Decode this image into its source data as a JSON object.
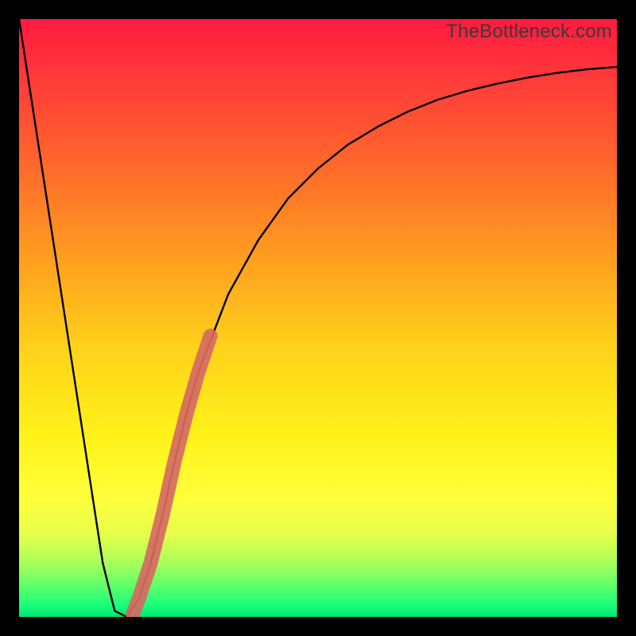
{
  "watermark": "TheBottleneck.com",
  "chart_data": {
    "type": "line",
    "title": "",
    "xlabel": "",
    "ylabel": "",
    "xlim": [
      0,
      100
    ],
    "ylim": [
      0,
      100
    ],
    "series": [
      {
        "name": "bottleneck-curve",
        "x": [
          0,
          2,
          4,
          6,
          8,
          10,
          12,
          14,
          16,
          18,
          20,
          22,
          24,
          26,
          28,
          30,
          35,
          40,
          45,
          50,
          55,
          60,
          65,
          70,
          75,
          80,
          85,
          90,
          95,
          100
        ],
        "values": [
          100,
          87,
          74,
          61,
          48,
          35,
          22,
          9,
          1,
          0,
          3,
          9,
          17,
          26,
          34,
          41,
          54,
          63,
          70,
          75,
          79,
          82,
          84.5,
          86.5,
          88,
          89.2,
          90.2,
          91,
          91.6,
          92
        ]
      }
    ],
    "highlight_segment": {
      "name": "highlighted-range",
      "color": "#d66a62",
      "x": [
        19,
        20,
        22,
        24,
        26,
        28,
        30,
        31,
        32
      ],
      "values": [
        0.5,
        3,
        9,
        17,
        26,
        34,
        41,
        44,
        47
      ]
    }
  }
}
